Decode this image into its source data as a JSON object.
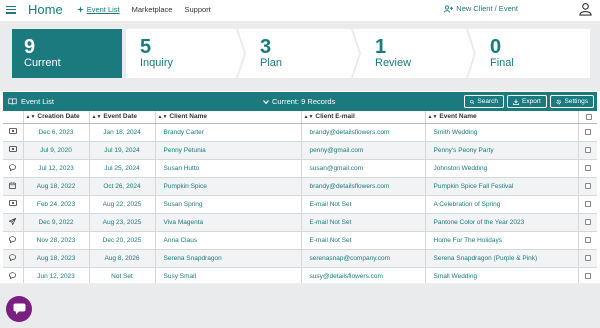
{
  "nav": {
    "home": "Home",
    "links": [
      {
        "label": "Event List",
        "active": true
      },
      {
        "label": "Marketplace",
        "active": false
      },
      {
        "label": "Support",
        "active": false
      }
    ],
    "new_client": "New Client / Event"
  },
  "stages": [
    {
      "count": "9",
      "label": "Current"
    },
    {
      "count": "5",
      "label": "Inquiry"
    },
    {
      "count": "3",
      "label": "Plan"
    },
    {
      "count": "1",
      "label": "Review"
    },
    {
      "count": "0",
      "label": "Final"
    }
  ],
  "panel": {
    "title": "Event List",
    "current_records": "Current: 9 Records",
    "search_label": "Search",
    "export_label": "Export",
    "settings_label": "Settings"
  },
  "columns": [
    "",
    "Creation Date",
    "Event Date",
    "Client Name",
    "Client E-mail",
    "Event Name",
    ""
  ],
  "rows": [
    {
      "icon": "money-icon",
      "created": "Dec 6, 2023",
      "event_date": "Jan 18, 2024",
      "client": "Brandy Carter",
      "email": "brandy@detailsflowers.com",
      "event": "Smith Wedding"
    },
    {
      "icon": "money-icon",
      "created": "Jul 9, 2020",
      "event_date": "Jul 19, 2024",
      "client": "Penny Petunia",
      "email": "penny@gmail.com",
      "event": "Penny's Peony Party"
    },
    {
      "icon": "chat-icon",
      "created": "Jul 12, 2023",
      "event_date": "Jul 25, 2024",
      "client": "Susan Hutto",
      "email": "susan@gmail.com",
      "event": "Johnston Wedding"
    },
    {
      "icon": "calendar-icon",
      "created": "Aug 18, 2022",
      "event_date": "Oct 26, 2024",
      "client": "Pumpkin Spice",
      "email": "brandy@detailsflowers.com",
      "event": "Pumpkin Spice Fall Festival"
    },
    {
      "icon": "money-icon",
      "created": "Feb 24, 2023",
      "event_date": "Aug 22, 2025",
      "client": "Susan Spring",
      "email": "E-mail Not Set",
      "event": "A Celebration of Spring"
    },
    {
      "icon": "send-icon",
      "created": "Dec 9, 2022",
      "event_date": "Aug 23, 2025",
      "client": "Viva Magenta",
      "email": "E-mail Not Set",
      "event": "Pantone Color of the Year 2023"
    },
    {
      "icon": "chat-icon",
      "created": "Nov 28, 2023",
      "event_date": "Dec 20, 2025",
      "client": "Anna Claus",
      "email": "E-mail Not Set",
      "event": "Home For The Holidays"
    },
    {
      "icon": "chat-icon",
      "created": "Aug 18, 2023",
      "event_date": "Aug 8, 2026",
      "client": "Serena Snapdragon",
      "email": "serenasnap@company.com",
      "event": "Serena Snapdragon (Purple & Pink)"
    },
    {
      "icon": "chat-icon",
      "created": "Jun 12, 2023",
      "event_date": "Not Set",
      "client": "Susy Small",
      "email": "susy@detailsflowers.com",
      "event": "Small Wedding"
    }
  ],
  "colors": {
    "accent": "#1a7a7e",
    "chat": "#7a1e7f",
    "background": "#e9ebec"
  }
}
